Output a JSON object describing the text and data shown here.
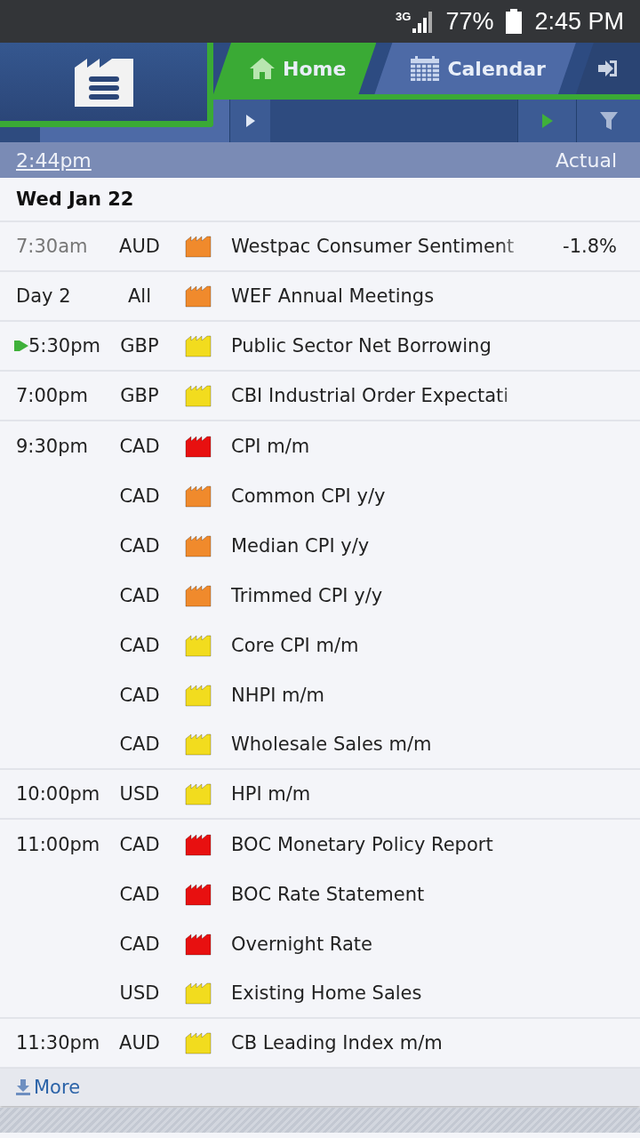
{
  "status_bar": {
    "network": "3G",
    "battery": "77%",
    "time": "2:45 PM"
  },
  "tabs": [
    {
      "label": "Home",
      "selected": true
    },
    {
      "label": "Calendar",
      "selected": false
    }
  ],
  "column_header": {
    "time_link": "2:44pm",
    "actual": "Actual"
  },
  "day": "Wed Jan 22",
  "groups": [
    {
      "time": "7:30am",
      "past": true,
      "next": false,
      "events": [
        {
          "currency": "AUD",
          "color": "#f08a2c",
          "title": "Westpac Consumer Sentiment",
          "actual": "-1.8%"
        }
      ]
    },
    {
      "time": "Day 2",
      "past": false,
      "next": false,
      "events": [
        {
          "currency": "All",
          "color": "#f08a2c",
          "title": "WEF Annual Meetings"
        }
      ]
    },
    {
      "time": "5:30pm",
      "past": false,
      "next": true,
      "events": [
        {
          "currency": "GBP",
          "color": "#f2dc1e",
          "title": "Public Sector Net Borrowing"
        }
      ]
    },
    {
      "time": "7:00pm",
      "past": false,
      "next": false,
      "events": [
        {
          "currency": "GBP",
          "color": "#f2dc1e",
          "title": "CBI Industrial Order Expectati"
        }
      ]
    },
    {
      "time": "9:30pm",
      "past": false,
      "next": false,
      "events": [
        {
          "currency": "CAD",
          "color": "#e81010",
          "title": "CPI m/m"
        },
        {
          "currency": "CAD",
          "color": "#f08a2c",
          "title": "Common CPI y/y"
        },
        {
          "currency": "CAD",
          "color": "#f08a2c",
          "title": "Median CPI y/y"
        },
        {
          "currency": "CAD",
          "color": "#f08a2c",
          "title": "Trimmed CPI y/y"
        },
        {
          "currency": "CAD",
          "color": "#f2dc1e",
          "title": "Core CPI m/m"
        },
        {
          "currency": "CAD",
          "color": "#f2dc1e",
          "title": "NHPI m/m"
        },
        {
          "currency": "CAD",
          "color": "#f2dc1e",
          "title": "Wholesale Sales m/m"
        }
      ]
    },
    {
      "time": "10:00pm",
      "past": false,
      "next": false,
      "events": [
        {
          "currency": "USD",
          "color": "#f2dc1e",
          "title": "HPI m/m"
        }
      ]
    },
    {
      "time": "11:00pm",
      "past": false,
      "next": false,
      "events": [
        {
          "currency": "CAD",
          "color": "#e81010",
          "title": "BOC Monetary Policy Report"
        },
        {
          "currency": "CAD",
          "color": "#e81010",
          "title": "BOC Rate Statement"
        },
        {
          "currency": "CAD",
          "color": "#e81010",
          "title": "Overnight Rate"
        },
        {
          "currency": "USD",
          "color": "#f2dc1e",
          "title": "Existing Home Sales"
        }
      ]
    },
    {
      "time": "11:30pm",
      "past": false,
      "next": false,
      "events": [
        {
          "currency": "AUD",
          "color": "#f2dc1e",
          "title": "CB Leading Index m/m"
        }
      ]
    }
  ],
  "more_link": "More"
}
